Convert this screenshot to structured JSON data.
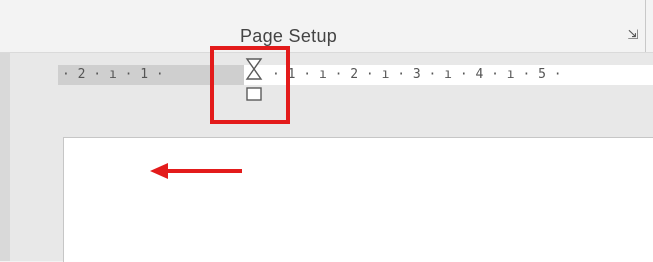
{
  "ribbon": {
    "group_label": "Page Setup",
    "launcher_icon": "dialog-launcher-icon"
  },
  "ruler": {
    "left_text": "· 2 · ı · 1 ·",
    "right_text": "· 1 · ı · 2 · ı · 3 · ı · 4 · ı · 5 ·",
    "indent_marker_icon": "hanging-indent-marker-icon"
  },
  "annotations": {
    "highlight_color": "#e31b1b",
    "arrow_direction": "left"
  }
}
